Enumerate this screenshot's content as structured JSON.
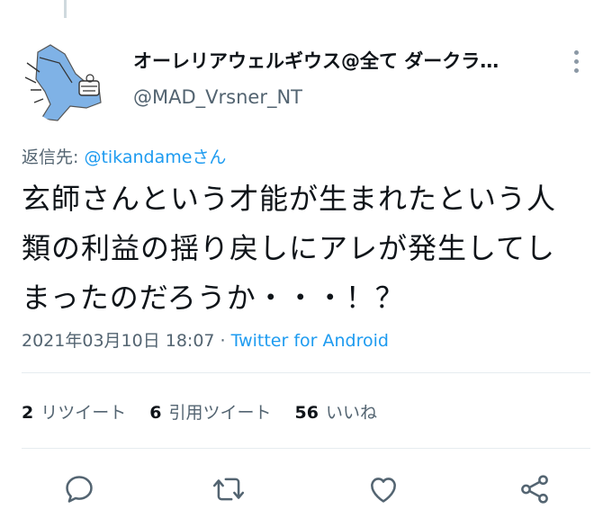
{
  "tweet": {
    "display_name": "オーレリアウェルギウス@全て ダークラ…",
    "handle": "@MAD_Vrsner_NT",
    "reply_label": "返信先:",
    "reply_mention": "@tikandameさん",
    "text_lines": [
      "玄師さんという才能が生まれたという人",
      "類の利益の揺り戻しにアレが発生してし",
      "まったのだろうか・・・！？"
    ],
    "timestamp": "2021年03月10日 18:07 · ",
    "source": "Twitter for Android"
  },
  "stats": {
    "retweets_count": "2",
    "retweets_label": "リツイート",
    "quotes_count": "6",
    "quotes_label": "引用ツイート",
    "likes_count": "56",
    "likes_label": "いいね"
  },
  "actions": {
    "icons": [
      "reply-icon",
      "retweet-icon",
      "like-icon",
      "share-icon"
    ]
  },
  "colors": {
    "accent": "#1d9bf0",
    "secondary_text": "#536471",
    "avatar_blue": "#7fb2e6"
  }
}
